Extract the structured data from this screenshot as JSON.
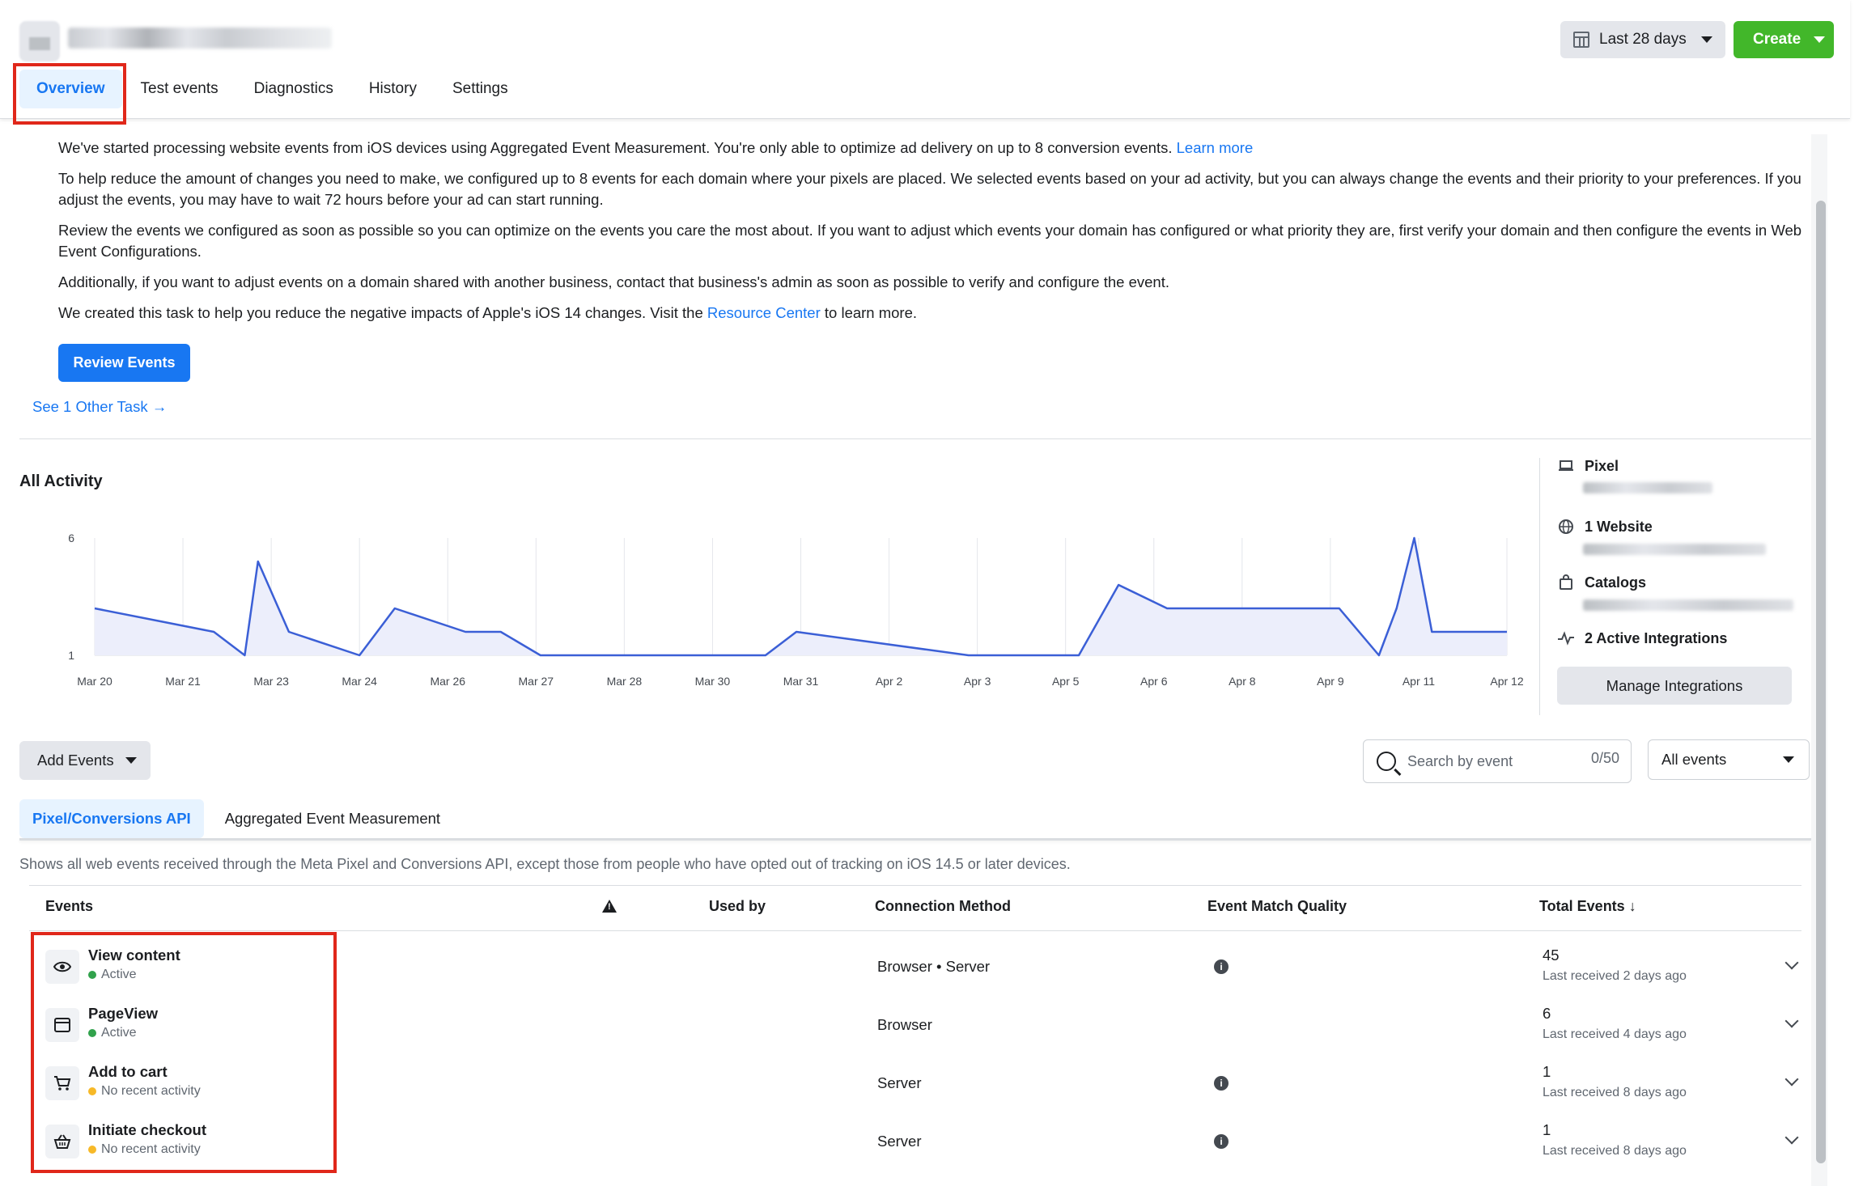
{
  "header": {
    "date_range": "Last 28 days",
    "create_label": "Create",
    "tabs": [
      {
        "label": "Overview"
      },
      {
        "label": "Test events"
      },
      {
        "label": "Diagnostics"
      },
      {
        "label": "History"
      },
      {
        "label": "Settings"
      }
    ]
  },
  "notice": {
    "p1_text": "We've started processing website events from iOS devices using Aggregated Event Measurement. You're only able to optimize ad delivery on up to 8 conversion events.",
    "p1_link": "Learn more",
    "p2": "To help reduce the amount of changes you need to make, we configured up to 8 events for each domain where your pixels are placed. We selected events based on your ad activity, but you can always change the events and their priority to your preferences. If you adjust the events, you may have to wait 72 hours before your ad can start running.",
    "p3": "Review the events we configured as soon as possible so you can optimize on the events you care the most about. If you want to adjust which events your domain has configured or what priority they are, first verify your domain and then configure the events in Web Event Configurations.",
    "p4": "Additionally, if you want to adjust events on a domain shared with another business, contact that business's admin as soon as possible to verify and configure the event.",
    "p5_before": "We created this task to help you reduce the negative impacts of Apple's iOS 14 changes. Visit the",
    "p5_link": "Resource Center",
    "p5_after": "to learn more.",
    "review_button": "Review Events",
    "see_task": "See 1 Other Task"
  },
  "activity": {
    "title": "All Activity"
  },
  "chart_data": {
    "type": "area",
    "title": "All Activity",
    "x_tick_labels": [
      "Mar 20",
      "Mar 21",
      "Mar 23",
      "Mar 24",
      "Mar 26",
      "Mar 27",
      "Mar 28",
      "Mar 30",
      "Mar 31",
      "Apr 2",
      "Apr 3",
      "Apr 5",
      "Apr 6",
      "Apr 8",
      "Apr 9",
      "Apr 11",
      "Apr 12"
    ],
    "y_tick_labels": [
      "6",
      "1"
    ],
    "ylim": [
      1,
      6
    ],
    "grid": "vertical",
    "series": [
      {
        "color": "#3b5fd6",
        "fill": "#eceefb",
        "x": [
          0,
          1.35,
          1.7,
          1.85,
          2.2,
          3.0,
          3.4,
          4.2,
          4.6,
          5.05,
          7.6,
          7.95,
          9.9,
          11.15,
          11.6,
          12.15,
          13.15,
          14.1,
          14.55,
          14.75,
          14.95,
          15.15,
          16.0
        ],
        "y": [
          3,
          2,
          1,
          5,
          2,
          1,
          3,
          2,
          2,
          1,
          1,
          2,
          1,
          1,
          4,
          3,
          3,
          3,
          1,
          3,
          6,
          2,
          2
        ]
      }
    ]
  },
  "side": {
    "pixel_label": "Pixel",
    "website_label": "1 Website",
    "catalogs_label": "Catalogs",
    "integrations_label": "2 Active Integrations",
    "manage_button": "Manage Integrations"
  },
  "controls": {
    "add_events": "Add Events",
    "search_placeholder": "Search by event",
    "search_count": "0/50",
    "filter_value": "All events",
    "subtabs": [
      {
        "label": "Pixel/Conversions API"
      },
      {
        "label": "Aggregated Event Measurement"
      }
    ],
    "description": "Shows all web events received through the Meta Pixel and Conversions API, except those from people who have opted out of tracking on iOS 14.5 or later devices."
  },
  "table": {
    "headers": {
      "events": "Events",
      "used_by": "Used by",
      "connection": "Connection Method",
      "emq": "Event Match Quality",
      "total": "Total Events ↓"
    },
    "rows": [
      {
        "name": "View content",
        "status": "Active",
        "status_color": "#31a24c",
        "icon": "eye-icon",
        "method": "Browser • Server",
        "total": "45",
        "last": "Last received 2 days ago"
      },
      {
        "name": "PageView",
        "status": "Active",
        "status_color": "#31a24c",
        "icon": "browser-window-icon",
        "method": "Browser",
        "total": "6",
        "last": "Last received 4 days ago"
      },
      {
        "name": "Add to cart",
        "status": "No recent activity",
        "status_color": "#f7b928",
        "icon": "cart-icon",
        "method": "Server",
        "total": "1",
        "last": "Last received 8 days ago"
      },
      {
        "name": "Initiate checkout",
        "status": "No recent activity",
        "status_color": "#f7b928",
        "icon": "basket-icon",
        "method": "Server",
        "total": "1",
        "last": "Last received 8 days ago"
      }
    ]
  }
}
